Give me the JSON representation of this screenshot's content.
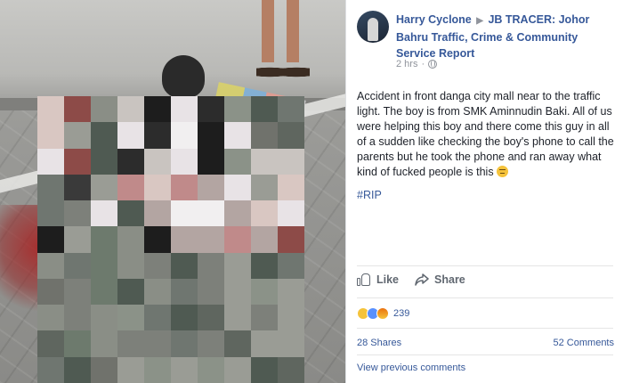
{
  "post": {
    "author_name": "Harry Cyclone",
    "arrow": "▶",
    "group_name": "JB TRACER: Johor Bahru Traffic, Crime & Community Service Report",
    "time": "2 hrs",
    "separator": "·",
    "text": "Accident in front danga city mall near to the traffic light. The boy is from SMK Aminnudin Baki. All of us were helping this boy and there come this guy in all of a sudden like checking the boy's phone to call the parents but he took the phone and ran away what kind of fucked people is this",
    "hashtag": "#RIP"
  },
  "actions": {
    "like_label": "Like",
    "share_label": "Share"
  },
  "reactions": {
    "icons": [
      "sad-reaction",
      "like-reaction",
      "angry-reaction"
    ],
    "count": "239"
  },
  "stats": {
    "shares": "28 Shares",
    "comments": "52 Comments"
  },
  "view_previous": "View previous comments",
  "colors": {
    "link_blue": "#365899",
    "meta_gray": "#90949c",
    "text": "#1d2129"
  }
}
